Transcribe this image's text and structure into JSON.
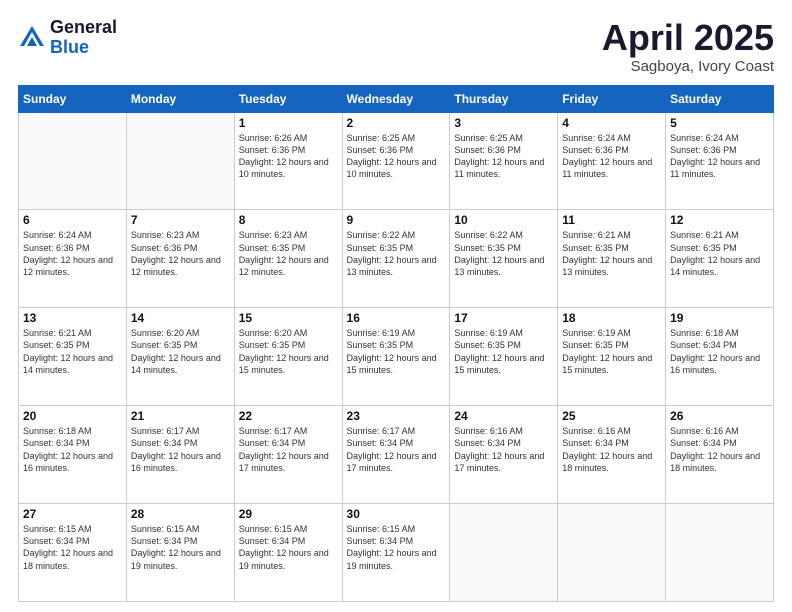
{
  "logo": {
    "general": "General",
    "blue": "Blue"
  },
  "title": {
    "month": "April 2025",
    "location": "Sagboya, Ivory Coast"
  },
  "days_header": [
    "Sunday",
    "Monday",
    "Tuesday",
    "Wednesday",
    "Thursday",
    "Friday",
    "Saturday"
  ],
  "weeks": [
    [
      {
        "day": "",
        "sunrise": "",
        "sunset": "",
        "daylight": ""
      },
      {
        "day": "",
        "sunrise": "",
        "sunset": "",
        "daylight": ""
      },
      {
        "day": "1",
        "sunrise": "Sunrise: 6:26 AM",
        "sunset": "Sunset: 6:36 PM",
        "daylight": "Daylight: 12 hours and 10 minutes."
      },
      {
        "day": "2",
        "sunrise": "Sunrise: 6:25 AM",
        "sunset": "Sunset: 6:36 PM",
        "daylight": "Daylight: 12 hours and 10 minutes."
      },
      {
        "day": "3",
        "sunrise": "Sunrise: 6:25 AM",
        "sunset": "Sunset: 6:36 PM",
        "daylight": "Daylight: 12 hours and 11 minutes."
      },
      {
        "day": "4",
        "sunrise": "Sunrise: 6:24 AM",
        "sunset": "Sunset: 6:36 PM",
        "daylight": "Daylight: 12 hours and 11 minutes."
      },
      {
        "day": "5",
        "sunrise": "Sunrise: 6:24 AM",
        "sunset": "Sunset: 6:36 PM",
        "daylight": "Daylight: 12 hours and 11 minutes."
      }
    ],
    [
      {
        "day": "6",
        "sunrise": "Sunrise: 6:24 AM",
        "sunset": "Sunset: 6:36 PM",
        "daylight": "Daylight: 12 hours and 12 minutes."
      },
      {
        "day": "7",
        "sunrise": "Sunrise: 6:23 AM",
        "sunset": "Sunset: 6:36 PM",
        "daylight": "Daylight: 12 hours and 12 minutes."
      },
      {
        "day": "8",
        "sunrise": "Sunrise: 6:23 AM",
        "sunset": "Sunset: 6:35 PM",
        "daylight": "Daylight: 12 hours and 12 minutes."
      },
      {
        "day": "9",
        "sunrise": "Sunrise: 6:22 AM",
        "sunset": "Sunset: 6:35 PM",
        "daylight": "Daylight: 12 hours and 13 minutes."
      },
      {
        "day": "10",
        "sunrise": "Sunrise: 6:22 AM",
        "sunset": "Sunset: 6:35 PM",
        "daylight": "Daylight: 12 hours and 13 minutes."
      },
      {
        "day": "11",
        "sunrise": "Sunrise: 6:21 AM",
        "sunset": "Sunset: 6:35 PM",
        "daylight": "Daylight: 12 hours and 13 minutes."
      },
      {
        "day": "12",
        "sunrise": "Sunrise: 6:21 AM",
        "sunset": "Sunset: 6:35 PM",
        "daylight": "Daylight: 12 hours and 14 minutes."
      }
    ],
    [
      {
        "day": "13",
        "sunrise": "Sunrise: 6:21 AM",
        "sunset": "Sunset: 6:35 PM",
        "daylight": "Daylight: 12 hours and 14 minutes."
      },
      {
        "day": "14",
        "sunrise": "Sunrise: 6:20 AM",
        "sunset": "Sunset: 6:35 PM",
        "daylight": "Daylight: 12 hours and 14 minutes."
      },
      {
        "day": "15",
        "sunrise": "Sunrise: 6:20 AM",
        "sunset": "Sunset: 6:35 PM",
        "daylight": "Daylight: 12 hours and 15 minutes."
      },
      {
        "day": "16",
        "sunrise": "Sunrise: 6:19 AM",
        "sunset": "Sunset: 6:35 PM",
        "daylight": "Daylight: 12 hours and 15 minutes."
      },
      {
        "day": "17",
        "sunrise": "Sunrise: 6:19 AM",
        "sunset": "Sunset: 6:35 PM",
        "daylight": "Daylight: 12 hours and 15 minutes."
      },
      {
        "day": "18",
        "sunrise": "Sunrise: 6:19 AM",
        "sunset": "Sunset: 6:35 PM",
        "daylight": "Daylight: 12 hours and 15 minutes."
      },
      {
        "day": "19",
        "sunrise": "Sunrise: 6:18 AM",
        "sunset": "Sunset: 6:34 PM",
        "daylight": "Daylight: 12 hours and 16 minutes."
      }
    ],
    [
      {
        "day": "20",
        "sunrise": "Sunrise: 6:18 AM",
        "sunset": "Sunset: 6:34 PM",
        "daylight": "Daylight: 12 hours and 16 minutes."
      },
      {
        "day": "21",
        "sunrise": "Sunrise: 6:17 AM",
        "sunset": "Sunset: 6:34 PM",
        "daylight": "Daylight: 12 hours and 16 minutes."
      },
      {
        "day": "22",
        "sunrise": "Sunrise: 6:17 AM",
        "sunset": "Sunset: 6:34 PM",
        "daylight": "Daylight: 12 hours and 17 minutes."
      },
      {
        "day": "23",
        "sunrise": "Sunrise: 6:17 AM",
        "sunset": "Sunset: 6:34 PM",
        "daylight": "Daylight: 12 hours and 17 minutes."
      },
      {
        "day": "24",
        "sunrise": "Sunrise: 6:16 AM",
        "sunset": "Sunset: 6:34 PM",
        "daylight": "Daylight: 12 hours and 17 minutes."
      },
      {
        "day": "25",
        "sunrise": "Sunrise: 6:16 AM",
        "sunset": "Sunset: 6:34 PM",
        "daylight": "Daylight: 12 hours and 18 minutes."
      },
      {
        "day": "26",
        "sunrise": "Sunrise: 6:16 AM",
        "sunset": "Sunset: 6:34 PM",
        "daylight": "Daylight: 12 hours and 18 minutes."
      }
    ],
    [
      {
        "day": "27",
        "sunrise": "Sunrise: 6:15 AM",
        "sunset": "Sunset: 6:34 PM",
        "daylight": "Daylight: 12 hours and 18 minutes."
      },
      {
        "day": "28",
        "sunrise": "Sunrise: 6:15 AM",
        "sunset": "Sunset: 6:34 PM",
        "daylight": "Daylight: 12 hours and 19 minutes."
      },
      {
        "day": "29",
        "sunrise": "Sunrise: 6:15 AM",
        "sunset": "Sunset: 6:34 PM",
        "daylight": "Daylight: 12 hours and 19 minutes."
      },
      {
        "day": "30",
        "sunrise": "Sunrise: 6:15 AM",
        "sunset": "Sunset: 6:34 PM",
        "daylight": "Daylight: 12 hours and 19 minutes."
      },
      {
        "day": "",
        "sunrise": "",
        "sunset": "",
        "daylight": ""
      },
      {
        "day": "",
        "sunrise": "",
        "sunset": "",
        "daylight": ""
      },
      {
        "day": "",
        "sunrise": "",
        "sunset": "",
        "daylight": ""
      }
    ]
  ]
}
